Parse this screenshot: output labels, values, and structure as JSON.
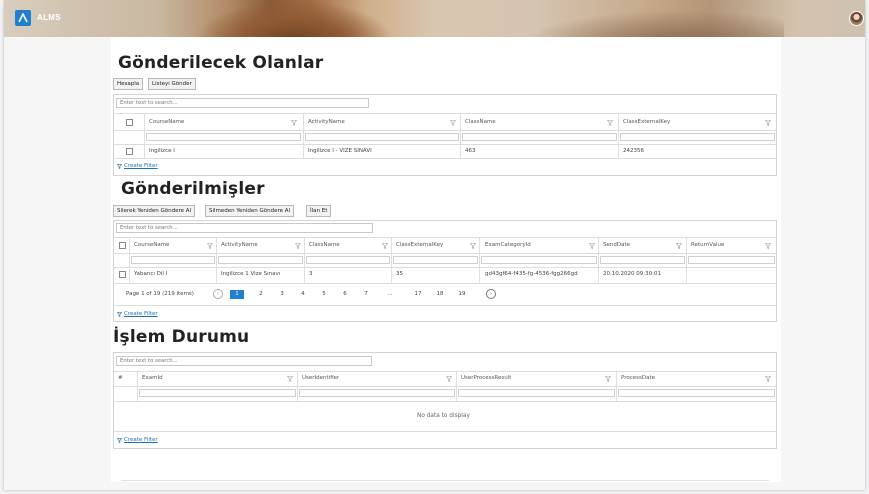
{
  "app": {
    "name": "ALMS"
  },
  "section1": {
    "title": "Gönderilecek Olanlar",
    "buttons": [
      "Hesapla",
      "Listeyi Gönder"
    ],
    "search_placeholder": "Enter text to search...",
    "columns": [
      "CourseName",
      "ActivityName",
      "ClassName",
      "ClassExternalKey"
    ],
    "rows": [
      [
        "İngilizce I",
        "İngilizce I - VİZE SINAVI",
        "463",
        "242356"
      ]
    ],
    "create_filter": "Create Filter"
  },
  "section2": {
    "title": "Gönderilmişler",
    "buttons": [
      "Silerek Yeniden Göndere Al",
      "Silmeden Yeniden Göndere Al",
      "İlan Et"
    ],
    "search_placeholder": "Enter text to search...",
    "columns": [
      "CourseName",
      "ActivityName",
      "ClassName",
      "ClassExternalKey",
      "ExamCategoryId",
      "SendDate",
      "ReturnValue"
    ],
    "rows": [
      [
        "Yabancı Dil I",
        "İngilizce 1 Vize Sınavı",
        "3",
        "35",
        "gd43gf64-f435-fg-4536-fgg266gd",
        "20.10.2020 09:30:01",
        ""
      ]
    ],
    "pager": {
      "summary": "Page 1 of 19 (219 items)",
      "pages": [
        "1",
        "2",
        "3",
        "4",
        "5",
        "6",
        "7",
        "...",
        "17",
        "18",
        "19"
      ],
      "current": "1"
    },
    "create_filter": "Create Filter"
  },
  "section3": {
    "title": "İşlem Durumu",
    "search_placeholder": "Enter text to search...",
    "columns": [
      "#",
      "ExamId",
      "UserIdentifier",
      "UserProcessResult",
      "ProcessDate"
    ],
    "empty_text": "No data to display",
    "create_filter": "Create Filter"
  }
}
